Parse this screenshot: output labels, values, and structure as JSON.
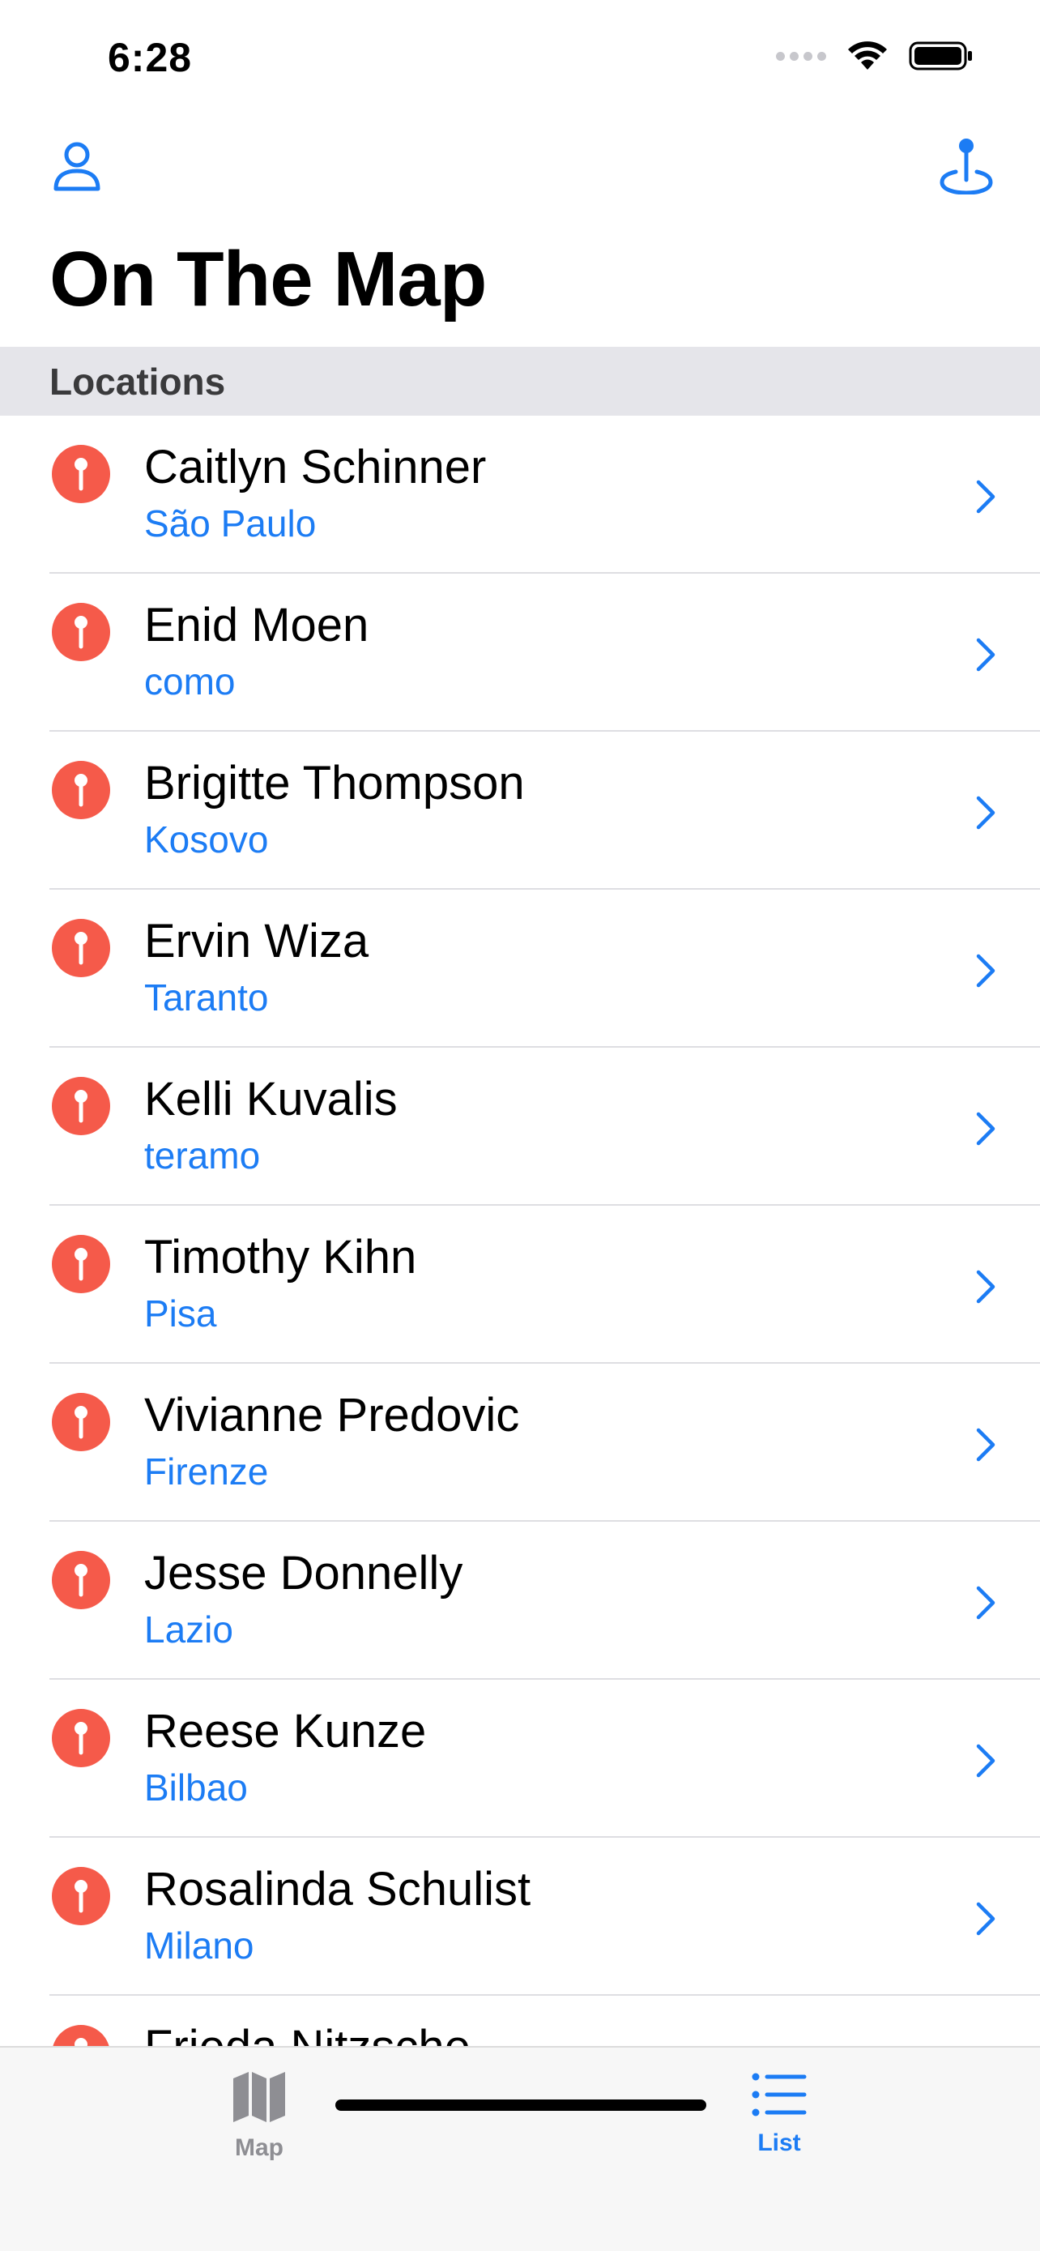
{
  "status_bar": {
    "time": "6:28"
  },
  "nav": {
    "title": "On The Map",
    "left_icon": "person-icon",
    "right_icon": "location-pin-icon"
  },
  "section": {
    "header": "Locations"
  },
  "locations": [
    {
      "name": "Caitlyn Schinner",
      "place": "São Paulo"
    },
    {
      "name": "Enid Moen",
      "place": "como"
    },
    {
      "name": "Brigitte Thompson",
      "place": "Kosovo"
    },
    {
      "name": "Ervin Wiza",
      "place": "Taranto"
    },
    {
      "name": "Kelli Kuvalis",
      "place": "teramo"
    },
    {
      "name": "Timothy Kihn",
      "place": "Pisa"
    },
    {
      "name": "Vivianne Predovic",
      "place": "Firenze"
    },
    {
      "name": "Jesse Donnelly",
      "place": "Lazio"
    },
    {
      "name": "Reese Kunze",
      "place": "Bilbao"
    },
    {
      "name": "Rosalinda Schulist",
      "place": "Milano"
    },
    {
      "name": "Frieda Nitzsche",
      "place": ""
    }
  ],
  "tab_bar": {
    "tabs": [
      {
        "label": "Map",
        "icon": "map-icon",
        "selected": false
      },
      {
        "label": "List",
        "icon": "list-icon",
        "selected": true
      }
    ]
  },
  "colors": {
    "accent": "#1c7cf4",
    "pin": "#f55a4a",
    "section_bg": "#e5e5ea"
  }
}
